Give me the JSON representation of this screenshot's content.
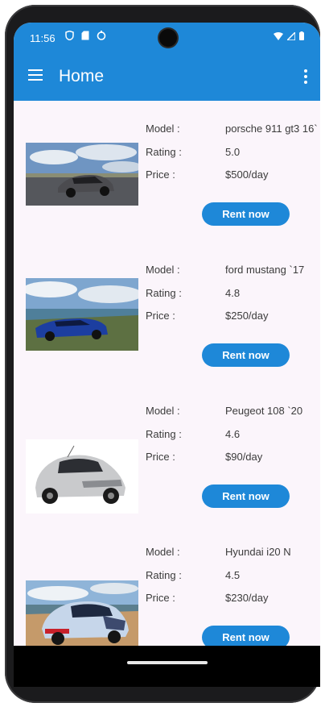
{
  "status_bar": {
    "time": "11:56"
  },
  "app_bar": {
    "title": "Home"
  },
  "labels": {
    "model": "Model :",
    "rating": "Rating :",
    "price": "Price :"
  },
  "cars": [
    {
      "model": "porsche 911 gt3 16`",
      "rating": "5.0",
      "price": "$500/day",
      "button": "Rent now"
    },
    {
      "model": "ford mustang `17",
      "rating": "4.8",
      "price": "$250/day",
      "button": "Rent now"
    },
    {
      "model": "Peugeot 108 `20",
      "rating": "4.6",
      "price": "$90/day",
      "button": "Rent now"
    },
    {
      "model": "Hyundai i20 N",
      "rating": "4.5",
      "price": "$230/day",
      "button": "Rent now"
    }
  ],
  "colors": {
    "primary": "#1e88d8",
    "background": "#fbf5fb"
  }
}
